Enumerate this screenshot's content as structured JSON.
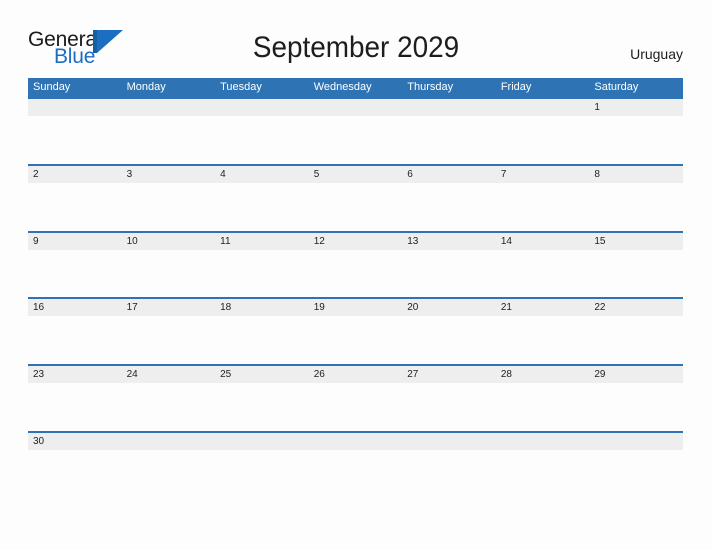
{
  "brand": {
    "word_one": "General",
    "word_two": "Blue",
    "flag_icon": "triangle-flag-icon",
    "primary_color": "#1b6ec2",
    "dark_color": "#1a1a1a"
  },
  "header": {
    "title": "September 2029",
    "locale": "Uruguay"
  },
  "calendar": {
    "header_color": "#2e74b5",
    "date_band_color": "#eeeeee",
    "row_border_color": "#2e74b5",
    "weekdays": [
      "Sunday",
      "Monday",
      "Tuesday",
      "Wednesday",
      "Thursday",
      "Friday",
      "Saturday"
    ],
    "weeks": [
      [
        "",
        "",
        "",
        "",
        "",
        "",
        "1"
      ],
      [
        "2",
        "3",
        "4",
        "5",
        "6",
        "7",
        "8"
      ],
      [
        "9",
        "10",
        "11",
        "12",
        "13",
        "14",
        "15"
      ],
      [
        "16",
        "17",
        "18",
        "19",
        "20",
        "21",
        "22"
      ],
      [
        "23",
        "24",
        "25",
        "26",
        "27",
        "28",
        "29"
      ],
      [
        "30",
        "",
        "",
        "",
        "",
        "",
        ""
      ]
    ]
  }
}
